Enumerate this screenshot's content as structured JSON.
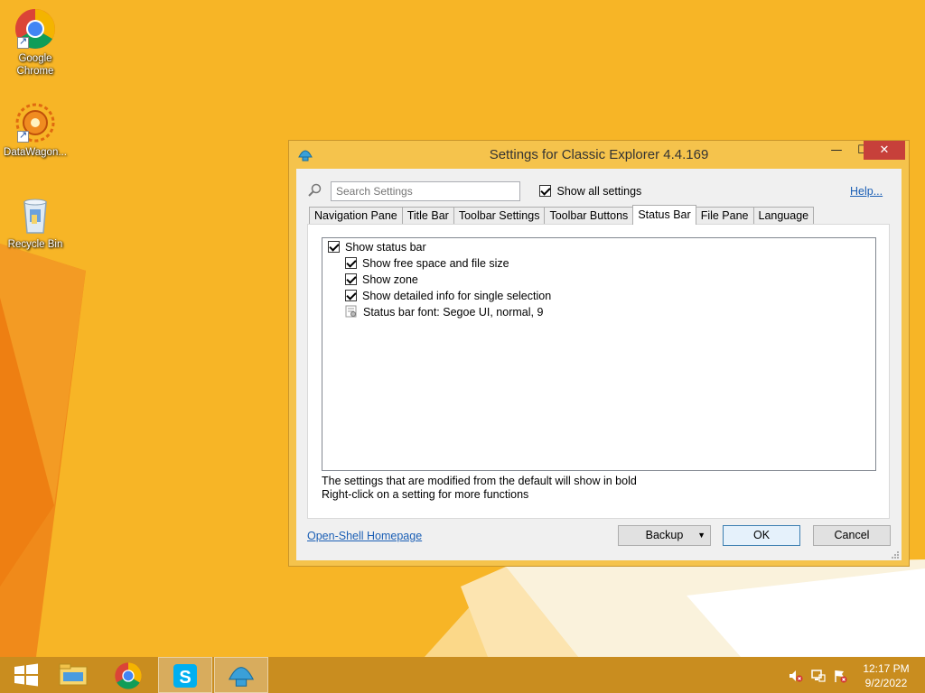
{
  "desktop": {
    "icons": [
      {
        "label": "Google Chrome"
      },
      {
        "label": "DataWagon..."
      },
      {
        "label": "Recycle Bin"
      }
    ]
  },
  "window": {
    "title": "Settings for Classic Explorer 4.4.169",
    "caption": {
      "minimize": "—",
      "maximize": "☐",
      "close": "✕"
    },
    "search": {
      "placeholder": "Search Settings",
      "value": ""
    },
    "show_all": {
      "label": "Show all settings",
      "checked": true
    },
    "help_label": "Help...",
    "tabs": [
      {
        "label": "Navigation Pane"
      },
      {
        "label": "Title Bar"
      },
      {
        "label": "Toolbar Settings"
      },
      {
        "label": "Toolbar Buttons"
      },
      {
        "label": "Status Bar",
        "active": true
      },
      {
        "label": "File Pane"
      },
      {
        "label": "Language"
      }
    ],
    "settings": [
      {
        "label": "Show status bar",
        "checked": true,
        "level": 0
      },
      {
        "label": "Show free space and file size",
        "checked": true,
        "level": 1
      },
      {
        "label": "Show zone",
        "checked": true,
        "level": 1
      },
      {
        "label": "Show detailed info for single selection",
        "checked": true,
        "level": 1
      },
      {
        "label": "Status bar font: Segoe UI, normal, 9",
        "icon": "font-icon",
        "level": 1
      }
    ],
    "hint_1": "The settings that are modified from the default will show in bold",
    "hint_2": "Right-click on a setting for more functions",
    "homepage_link": "Open-Shell Homepage",
    "buttons": {
      "backup": "Backup",
      "ok": "OK",
      "cancel": "Cancel"
    }
  },
  "taskbar": {
    "items": [
      {
        "icon": "windows-start-icon"
      },
      {
        "icon": "file-explorer-icon"
      },
      {
        "icon": "chrome-icon"
      },
      {
        "icon": "skype-icon",
        "active": true
      },
      {
        "icon": "open-shell-icon",
        "active": true
      }
    ],
    "tray": [
      "volume-muted-icon",
      "network-icon",
      "action-center-flag-icon"
    ],
    "clock": {
      "time": "12:17 PM",
      "date": "9/2/2022"
    }
  },
  "colors": {
    "wallpaper": "#f6b325",
    "window_frame": "#f5c34c",
    "close_button": "#c7403a",
    "taskbar": "#c98d1f",
    "link": "#1b5fb5"
  }
}
